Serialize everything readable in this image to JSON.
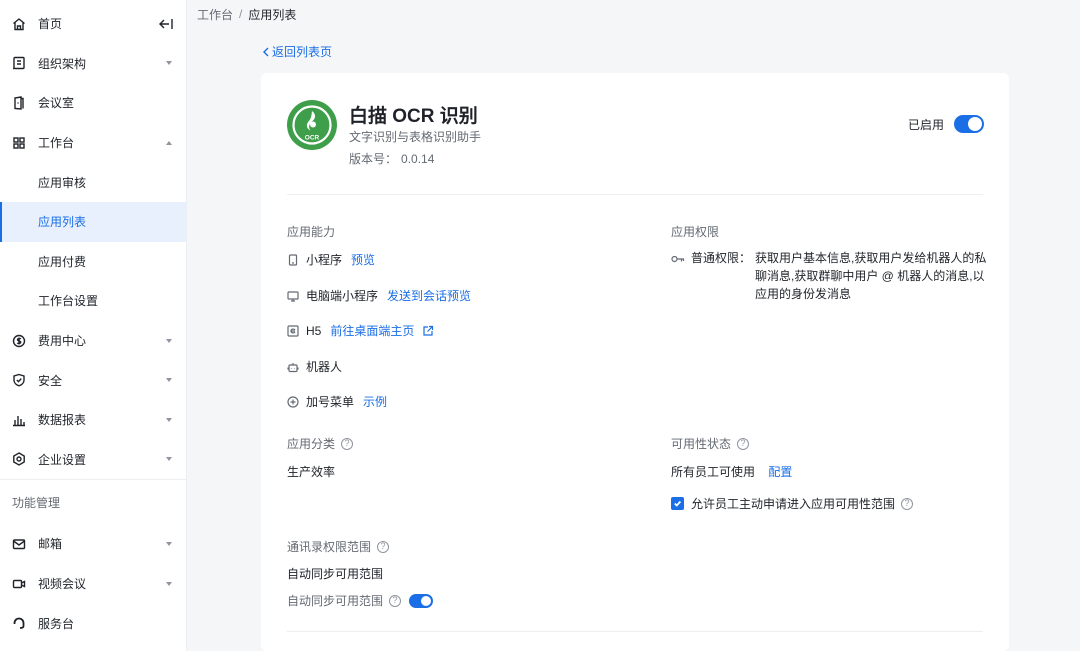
{
  "sidebar": {
    "items": [
      {
        "label": "首页"
      },
      {
        "label": "组织架构"
      },
      {
        "label": "会议室"
      },
      {
        "label": "工作台"
      },
      {
        "label": "费用中心"
      },
      {
        "label": "安全"
      },
      {
        "label": "数据报表"
      },
      {
        "label": "企业设置"
      },
      {
        "label": "邮箱"
      },
      {
        "label": "视频会议"
      },
      {
        "label": "服务台"
      }
    ],
    "workbench_sub": [
      {
        "label": "应用审核"
      },
      {
        "label": "应用列表"
      },
      {
        "label": "应用付费"
      },
      {
        "label": "工作台设置"
      }
    ],
    "group_title": "功能管理"
  },
  "breadcrumb": {
    "parent": "工作台",
    "separator": "/",
    "current": "应用列表"
  },
  "back_link": "返回列表页",
  "app": {
    "name": "白描 OCR 识别",
    "description": "文字识别与表格识别助手",
    "version_label": "版本号：",
    "version": "0.0.14",
    "logo_text": "OCR",
    "status_label": "已启用"
  },
  "capabilities": {
    "title": "应用能力",
    "items": [
      {
        "label": "小程序",
        "link": "预览"
      },
      {
        "label": "电脑端小程序",
        "link": "发送到会话预览"
      },
      {
        "label": "H5",
        "link": "前往桌面端主页"
      },
      {
        "label": "机器人",
        "link": ""
      },
      {
        "label": "加号菜单",
        "link": "示例"
      }
    ]
  },
  "permissions": {
    "title": "应用权限",
    "label": "普通权限：",
    "text": "获取用户基本信息,获取用户发给机器人的私聊消息,获取群聊中用户 @ 机器人的消息,以应用的身份发消息"
  },
  "category": {
    "title": "应用分类",
    "value": "生产效率"
  },
  "availability": {
    "title": "可用性状态",
    "value": "所有员工可使用",
    "config_link": "配置",
    "checkbox_label": "允许员工主动申请进入应用可用性范围"
  },
  "contacts_scope": {
    "title": "通讯录权限范围",
    "value": "自动同步可用范围",
    "toggle_label": "自动同步可用范围"
  },
  "colors": {
    "accent": "#1a6ee6",
    "logo_green": "#3f9e4a"
  }
}
